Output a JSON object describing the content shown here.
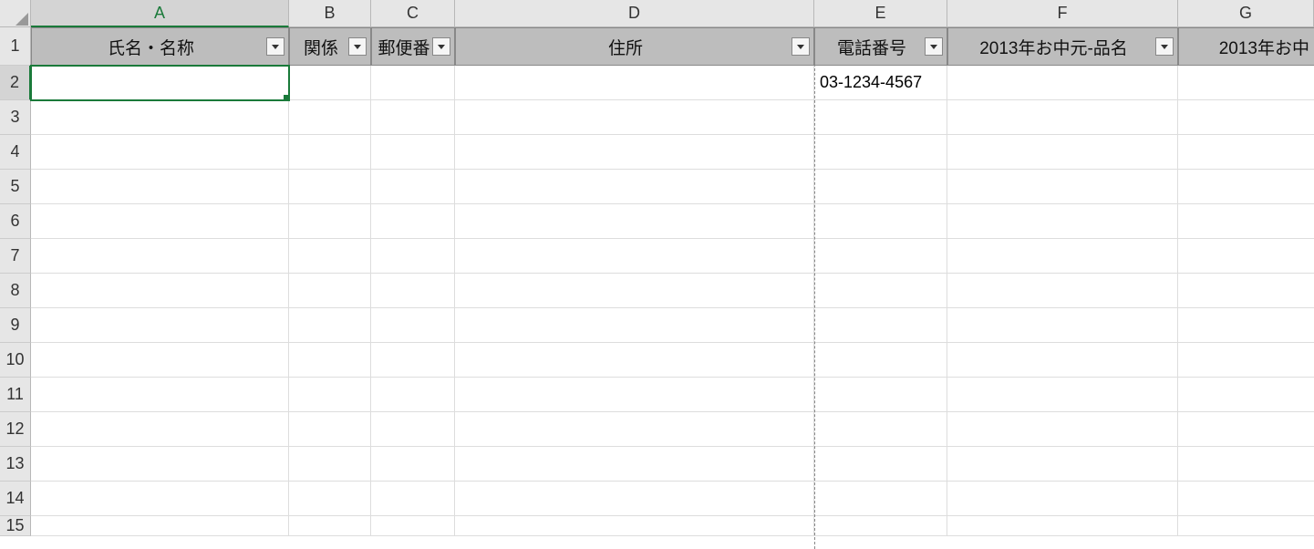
{
  "columns": [
    "A",
    "B",
    "C",
    "D",
    "E",
    "F",
    "G"
  ],
  "row_numbers": [
    1,
    2,
    3,
    4,
    5,
    6,
    7,
    8,
    9,
    10,
    11,
    12,
    13,
    14,
    15
  ],
  "active_col": "A",
  "active_row": 2,
  "headers": {
    "A": "氏名・名称",
    "B": "関係",
    "C": "郵便番",
    "D": "住所",
    "E": "電話番号",
    "F": "2013年お中元-品名",
    "G": "2013年お中"
  },
  "data_rows": [
    {
      "A": "",
      "B": "",
      "C": "",
      "D": "",
      "E": "03-1234-4567",
      "F": "",
      "G": ""
    }
  ]
}
